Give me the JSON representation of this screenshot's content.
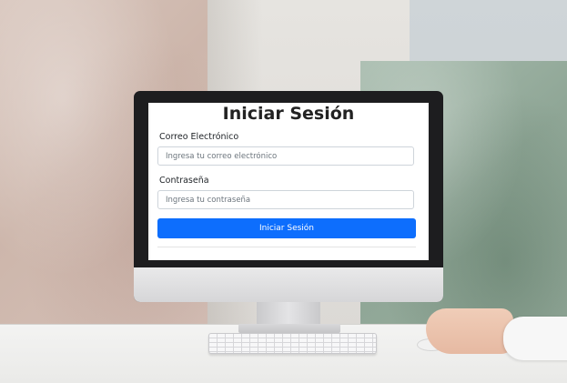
{
  "login": {
    "title": "Iniciar Sesión",
    "email_label": "Correo Electrónico",
    "email_placeholder": "Ingresa tu correo electrónico",
    "email_value": "",
    "password_label": "Contraseña",
    "password_placeholder": "Ingresa tu contraseña",
    "password_value": "",
    "submit_label": "Iniciar Sesión"
  },
  "colors": {
    "primary_button": "#0d6efd",
    "title_text": "#222222"
  }
}
